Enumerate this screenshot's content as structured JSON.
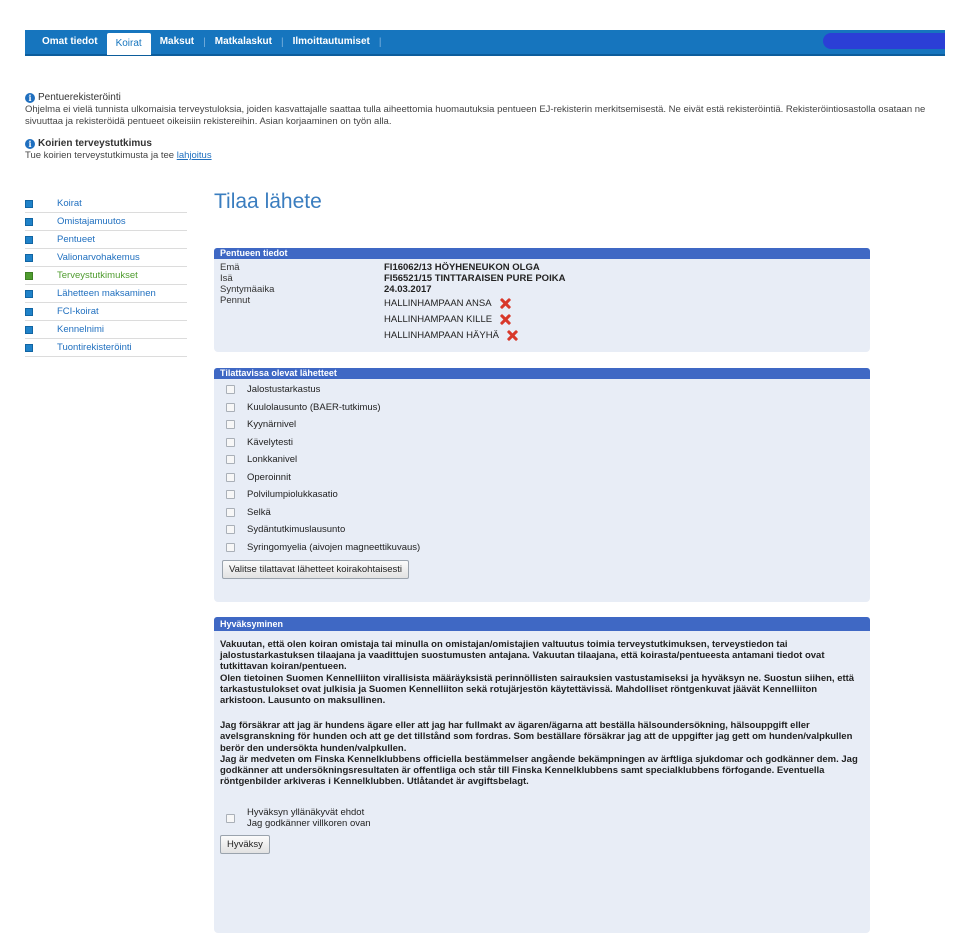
{
  "nav": {
    "tabs": [
      "Omat tiedot",
      "Koirat",
      "Maksut",
      "Matkalaskut",
      "Ilmoittautumiset"
    ],
    "active_tab": "Koirat"
  },
  "notice": {
    "pentue_title": "Pentuerekisteröinti",
    "pentue_text": "Ohjelma ei vielä tunnista ulkomaisia terveystuloksia, joiden kasvattajalle saattaa tulla aiheettomia huomautuksia pentueen EJ-rekisterin merkitsemisestä. Ne eivät estä rekisteröintiä. Rekisteröintiosastolla osataan ne sivuuttaa ja rekisteröidä pentueet oikeisiin rekistereihin. Asian korjaaminen on työn alla.",
    "terveys_title": "Koirien terveystutkimus",
    "terveys_text": "Tue koirien terveystutkimusta ja tee",
    "terveys_link": "lahjoitus"
  },
  "sidebar": {
    "items": [
      "Koirat",
      "Omistajamuutos",
      "Pentueet",
      "Valionarvohakemus",
      "Terveystutkimukset",
      "Lähetteen maksaminen",
      "FCI-koirat",
      "Kennelnimi",
      "Tuontirekisteröinti"
    ],
    "active": "Terveystutkimukset"
  },
  "page": {
    "title": "Tilaa lähete"
  },
  "litter": {
    "header": "Pentueen tiedot",
    "rows": [
      {
        "label": "Emä",
        "value": "FI16062/13 HÖYHENEUKON OLGA"
      },
      {
        "label": "Isä",
        "value": "FI56521/15 TINTTARAISEN PURE POIKA"
      },
      {
        "label": "Syntymäaika",
        "value": "24.03.2017"
      }
    ],
    "puppies_label": "Pennut",
    "puppies": [
      "HALLINHAMPAAN ANSA",
      "HALLINHAMPAAN KILLE",
      "HALLINHAMPAAN HÄYHÄ"
    ]
  },
  "referrals": {
    "header": "Tilattavissa olevat lähetteet",
    "items": [
      "Jalostustarkastus",
      "Kuulolausunto (BAER-tutkimus)",
      "Kyynärnivel",
      "Kävelytesti",
      "Lonkkanivel",
      "Operoinnit",
      "Polvilumpiolukkasatio",
      "Selkä",
      "Sydäntutkimuslausunto",
      "Syringomyelia (aivojen magneettikuvaus)"
    ],
    "button": "Valitse tilattavat lähetteet koirakohtaisesti"
  },
  "approval": {
    "header": "Hyväksyminen",
    "fi_1": "Vakuutan, että olen koiran omistaja tai minulla on omistajan/omistajien valtuutus toimia terveystutkimuksen, terveystiedon tai jalostustarkastuksen tilaajana ja vaadittujen suostumusten antajana. Vakuutan tilaajana, että koirasta/pentueesta antamani tiedot ovat tutkittavan koiran/pentueen.",
    "fi_2": "Olen tietoinen Suomen Kennelliiton virallisista määräyksistä perinnöllisten sairauksien vastustamiseksi ja hyväksyn ne. Suostun siihen, että tarkastustulokset ovat julkisia ja Suomen Kennelliiton sekä rotujärjestön käytettävissä. Mahdolliset röntgenkuvat jäävät Kennelliiton arkistoon. Lausunto on maksullinen.",
    "sv_1": "Jag försäkrar att jag är hundens ägare eller att jag har fullmakt av ägaren/ägarna att beställa hälsoundersökning, hälsouppgift eller avelsgranskning för hunden och att ge det tillstånd som fordras. Som beställare försäkrar jag att de uppgifter jag gett om hunden/valpkullen berör den undersökta hunden/valpkullen.",
    "sv_2": "Jag är medveten om Finska Kennelklubbens officiella bestämmelser angående bekämpningen av ärftliga sjukdomar och godkänner dem. Jag godkänner att undersökningsresultaten är offentliga och står till Finska Kennelklubbens samt specialklubbens förfogande. Eventuella röntgenbilder arkiveras i Kennelklubben. Utlåtandet är avgiftsbelagt.",
    "checkbox_fi": "Hyväksyn yllänäkyvät ehdot",
    "checkbox_sv": "Jag godkänner villkoren ovan",
    "button": "Hyväksy"
  },
  "colors": {
    "nav_bg": "#1675be",
    "panel_header": "#3f68c4",
    "panel_bg": "#e8edf6",
    "title": "#3a7dbf",
    "active_side": "#4f9c2f",
    "remove": "#d8382a"
  }
}
